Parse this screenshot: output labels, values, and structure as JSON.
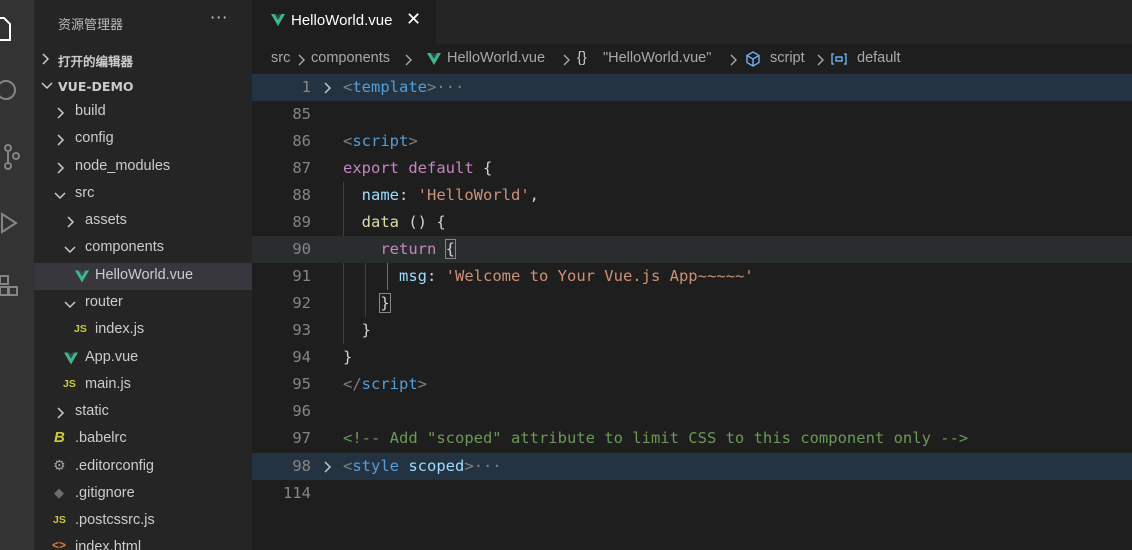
{
  "sidebar": {
    "title": "资源管理器",
    "more": "···",
    "open_editors": "打开的编辑器",
    "project": "VUE-DEMO",
    "items": [
      {
        "label": "build",
        "icon": "chevron-right-icon"
      },
      {
        "label": "config",
        "icon": "chevron-right-icon"
      },
      {
        "label": "node_modules",
        "icon": "chevron-right-icon"
      },
      {
        "label": "src",
        "icon": "chevron-down-icon"
      },
      {
        "label": "assets",
        "icon": "chevron-right-icon"
      },
      {
        "label": "components",
        "icon": "chevron-down-icon"
      },
      {
        "label": "HelloWorld.vue",
        "icon": "vue-file-icon"
      },
      {
        "label": "router",
        "icon": "chevron-down-icon"
      },
      {
        "label": "index.js",
        "icon": "js-file-icon"
      },
      {
        "label": "App.vue",
        "icon": "vue-file-icon"
      },
      {
        "label": "main.js",
        "icon": "js-file-icon"
      },
      {
        "label": "static",
        "icon": "chevron-right-icon"
      },
      {
        "label": ".babelrc",
        "icon": "babel-file-icon"
      },
      {
        "label": ".editorconfig",
        "icon": "gear-file-icon"
      },
      {
        "label": ".gitignore",
        "icon": "git-file-icon"
      },
      {
        "label": ".postcssrc.js",
        "icon": "js-file-icon"
      },
      {
        "label": "index.html",
        "icon": "html-file-icon"
      }
    ],
    "icon_text": {
      "js": "JS",
      "babel": "B",
      "gear": "⚙",
      "git": "◆",
      "html": "<>"
    }
  },
  "tab": {
    "title": "HelloWorld.vue",
    "close": "✕"
  },
  "breadcrumb": {
    "src": "src",
    "components": "components",
    "file": "HelloWorld.vue",
    "braces": "{}",
    "component": "\"HelloWorld.vue\"",
    "script": "script",
    "default": "default"
  },
  "code": {
    "line_numbers": [
      "1",
      "85",
      "86",
      "87",
      "88",
      "89",
      "90",
      "91",
      "92",
      "93",
      "94",
      "95",
      "96",
      "97",
      "98",
      "114"
    ],
    "l1_open": "<",
    "l1_tag": "template",
    "l1_close": ">",
    "l1_ellipsis": "···",
    "l86_open": "<",
    "l86_tag": "script",
    "l86_close": ">",
    "l87_kw": "export default",
    "l87_rest": " {",
    "l88_prop": "name",
    "l88_colon": ": ",
    "l88_str": "'HelloWorld'",
    "l88_end": ",",
    "l89_fn": "data",
    "l89_rest": " () {",
    "l90_kw": "return",
    "l90_brace": "{",
    "l91_prop": "msg",
    "l91_colon": ": ",
    "l91_str": "'Welcome to Your Vue.js App~~~~~'",
    "l92_brace": "}",
    "l93_brace": "}",
    "l94_brace": "}",
    "l95_open": "</",
    "l95_tag": "script",
    "l95_close": ">",
    "l97_comment": "<!-- Add \"scoped\" attribute to limit CSS to this component only -->",
    "l98_open": "<",
    "l98_tag": "style",
    "l98_attr": " scoped",
    "l98_close": ">",
    "l98_ellipsis": "···"
  },
  "colors": {
    "vue": "#41b883",
    "keyword": "#c586c0",
    "string": "#ce9178",
    "tag": "#569cd6",
    "property": "#9cdcfe",
    "comment": "#6a9955"
  }
}
